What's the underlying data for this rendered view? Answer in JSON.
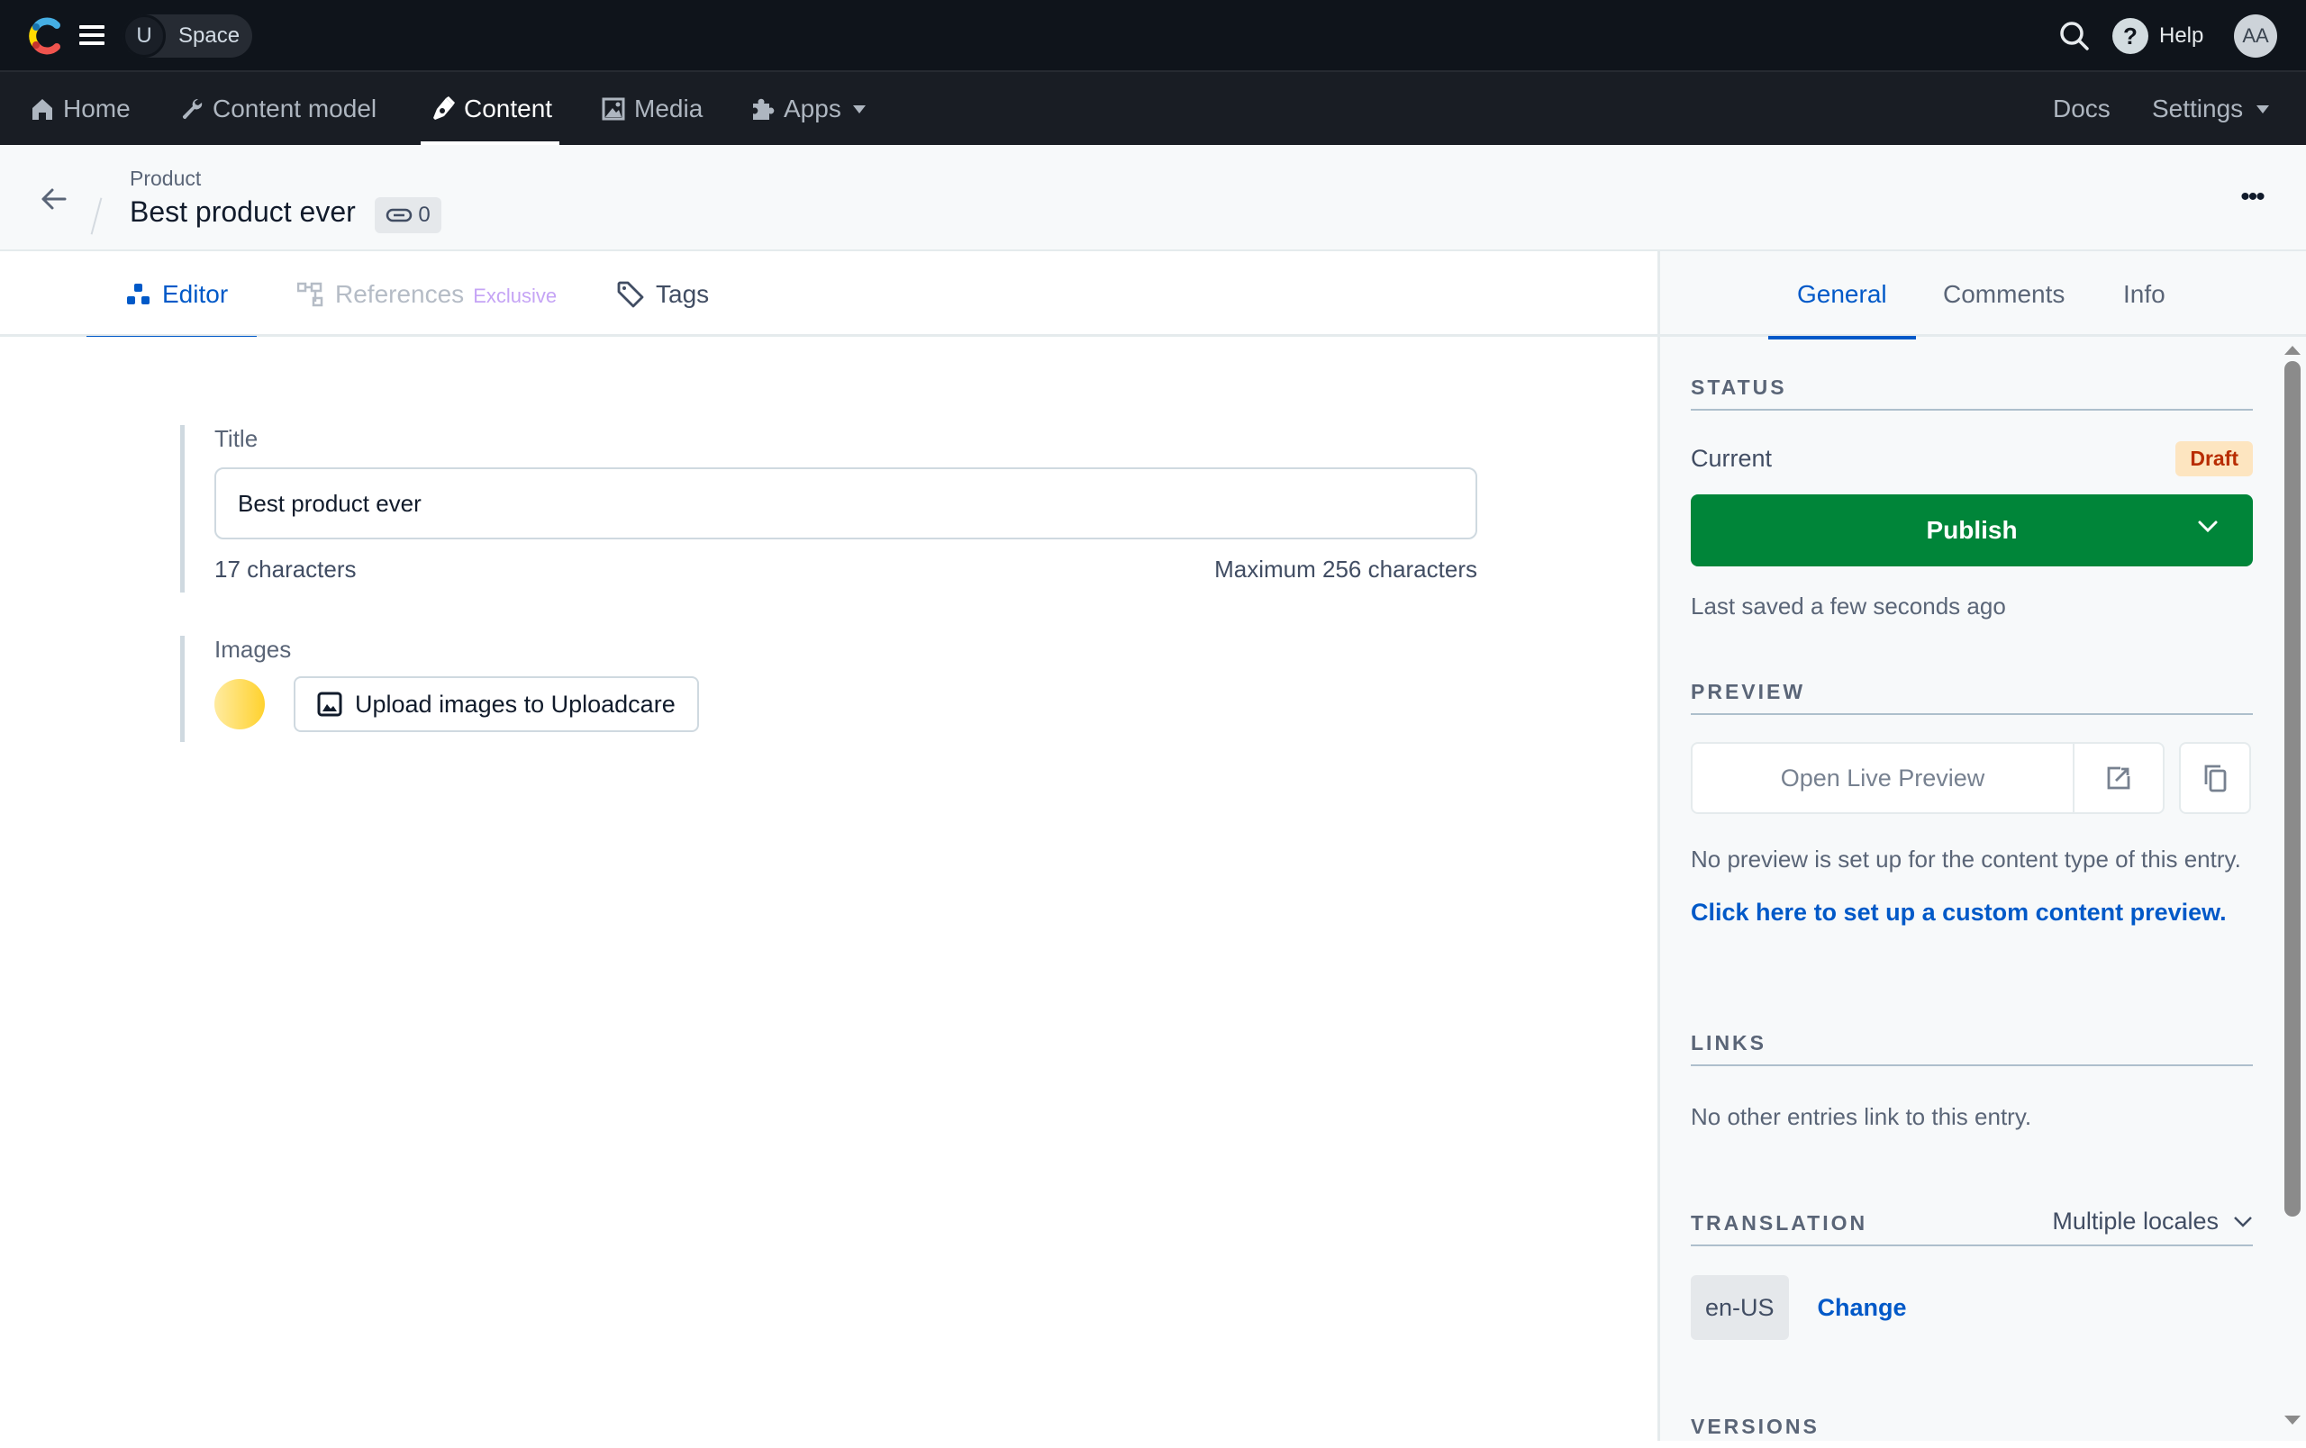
{
  "topbar": {
    "space_initial": "U",
    "space_name": "Space",
    "help_label": "Help",
    "avatar_initials": "AA"
  },
  "nav": {
    "items": [
      {
        "label": "Home",
        "icon": "home-icon"
      },
      {
        "label": "Content model",
        "icon": "wrench-icon"
      },
      {
        "label": "Content",
        "icon": "pen-nib-icon",
        "active": true
      },
      {
        "label": "Media",
        "icon": "image-icon"
      },
      {
        "label": "Apps",
        "icon": "puzzle-icon",
        "dropdown": true
      }
    ],
    "right": [
      {
        "label": "Docs"
      },
      {
        "label": "Settings",
        "dropdown": true
      }
    ]
  },
  "header": {
    "content_type": "Product",
    "entry_title": "Best product ever",
    "link_count": "0"
  },
  "tabs": [
    {
      "label": "Editor",
      "active": true
    },
    {
      "label": "References",
      "badge": "Exclusive",
      "disabled": true
    },
    {
      "label": "Tags"
    }
  ],
  "editor": {
    "title_field": {
      "label": "Title",
      "value": "Best product ever",
      "char_count": "17 characters",
      "max_chars": "Maximum 256 characters"
    },
    "images_field": {
      "label": "Images",
      "upload_label": "Upload images to Uploadcare"
    }
  },
  "sidebar": {
    "tabs": [
      {
        "label": "General",
        "active": true
      },
      {
        "label": "Comments"
      },
      {
        "label": "Info"
      }
    ],
    "status": {
      "heading": "STATUS",
      "current_label": "Current",
      "badge": "Draft",
      "publish_label": "Publish",
      "last_saved": "Last saved a few seconds ago"
    },
    "preview": {
      "heading": "PREVIEW",
      "open_label": "Open Live Preview",
      "note": "No preview is set up for the content type of this entry.",
      "setup_link": "Click here to set up a custom content preview."
    },
    "links": {
      "heading": "LINKS",
      "note": "No other entries link to this entry."
    },
    "translation": {
      "heading": "TRANSLATION",
      "mode": "Multiple locales",
      "locale": "en-US",
      "change_label": "Change"
    },
    "versions": {
      "heading": "VERSIONS"
    }
  },
  "colors": {
    "accent": "#0059c8",
    "publish": "#008539",
    "draft_bg": "#fde5c0",
    "draft_text": "#b82c00",
    "topbar_bg": "#0f141b",
    "navbar_bg": "#191d24"
  }
}
